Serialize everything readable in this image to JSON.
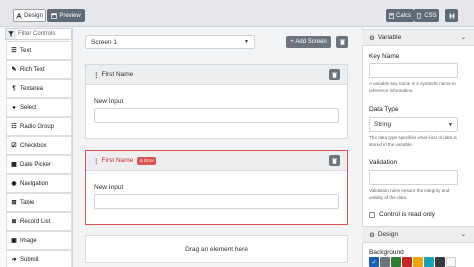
{
  "toolbar": {
    "design_label": "Design",
    "preview_label": "Preview",
    "calcs_label": "Calcs",
    "css_label": "CSS"
  },
  "sidebar": {
    "filter_placeholder": "Filter Controls",
    "controls": [
      {
        "label": "Text",
        "icon": "text-icon"
      },
      {
        "label": "Rich Text",
        "icon": "rich-text-icon"
      },
      {
        "label": "Textarea",
        "icon": "textarea-icon"
      },
      {
        "label": "Select",
        "icon": "select-icon"
      },
      {
        "label": "Radio Group",
        "icon": "radio-group-icon"
      },
      {
        "label": "Checkbox",
        "icon": "checkbox-icon"
      },
      {
        "label": "Date Picker",
        "icon": "date-picker-icon"
      },
      {
        "label": "Navigation",
        "icon": "navigation-icon"
      },
      {
        "label": "Table",
        "icon": "table-icon"
      },
      {
        "label": "Record List",
        "icon": "record-list-icon"
      },
      {
        "label": "Image",
        "icon": "image-icon"
      },
      {
        "label": "Submit",
        "icon": "submit-icon"
      }
    ]
  },
  "canvas": {
    "screen_value": "Screen 1",
    "add_screen_label": "Add Screen",
    "cards": [
      {
        "title": "First Name",
        "field_label": "New Input",
        "error": false
      },
      {
        "title": "First Name",
        "field_label": "New Input",
        "error": true,
        "error_label": "Error"
      }
    ],
    "dropzone_text": "Drag an element here"
  },
  "inspector": {
    "variable_header": "Variable",
    "key_name_label": "Key Name",
    "key_name_help": "A variable key name is a symbolic name to reference information.",
    "data_type_label": "Data Type",
    "data_type_value": "String",
    "data_type_help": "The data type specifies what kind of data is stored in the variable.",
    "validation_label": "Validation",
    "validation_help": "Validation rules ensure the integrity and validity of the data.",
    "readonly_label": "Control is read only",
    "design_header": "Design",
    "background_label": "Background",
    "swatches": [
      "#1a5fb4",
      "#6c757d",
      "#2e7d32",
      "#c62828",
      "#f0a500",
      "#17a2b8",
      "#343a40",
      "#f8f9fa"
    ]
  }
}
